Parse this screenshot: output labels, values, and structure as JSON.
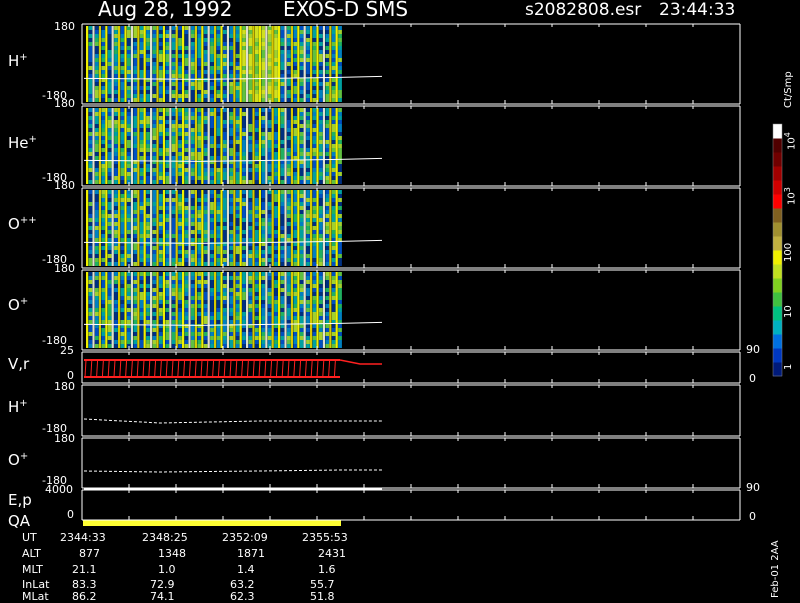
{
  "header": {
    "date": "Aug 28, 1992",
    "instrument": "EXOS-D SMS",
    "file": "s2082808.esr",
    "time": "23:44:33"
  },
  "panels": {
    "hplus": {
      "label": "H",
      "sup": "+",
      "ytop": "180",
      "ybot": "-180"
    },
    "heplus": {
      "label": "He",
      "sup": "+",
      "ytop": "180",
      "ybot": "-180"
    },
    "oplusplus": {
      "label": "O",
      "sup": "++",
      "ytop": "180",
      "ybot": "-180"
    },
    "oplus": {
      "label": "O",
      "sup": "+",
      "ytop": "180",
      "ybot": "-180"
    },
    "vr": {
      "label": "V,r",
      "ytop": "25",
      "ybot": "0",
      "rtop": "90",
      "rbot": "0"
    },
    "hplus2": {
      "label": "H",
      "sup": "+",
      "ytop": "180",
      "ybot": "-180"
    },
    "oplus2": {
      "label": "O",
      "sup": "+",
      "ytop": "180",
      "ybot": "-180"
    },
    "ep": {
      "label": "E,p",
      "ytop": "4000",
      "rtop": "90"
    },
    "qa": {
      "label": "QA",
      "ybot": "0",
      "rbot": "0"
    }
  },
  "colorbar": {
    "unit": "Ct/Smp",
    "ticks": [
      "1",
      "10",
      "100",
      "10",
      "10"
    ],
    "exponents": [
      "",
      "",
      "",
      "3",
      "4"
    ],
    "colors": [
      "#001a7a",
      "#0038c0",
      "#0070e0",
      "#00b0c0",
      "#00c080",
      "#40c040",
      "#80d020",
      "#c0e020",
      "#f0f000",
      "#c0b040",
      "#a09030",
      "#806020",
      "#ff0000",
      "#d00000",
      "#a00000",
      "#700000",
      "#500000",
      "#ffffff"
    ]
  },
  "footer": {
    "rows": [
      {
        "label": "UT",
        "values": [
          "2344:33",
          "2348:25",
          "2352:09",
          "2355:53"
        ]
      },
      {
        "label": "ALT",
        "values": [
          "877",
          "1348",
          "1871",
          "2431"
        ]
      },
      {
        "label": "MLT",
        "values": [
          "21.1",
          "1.0",
          "1.4",
          "1.6"
        ]
      },
      {
        "label": "InLat",
        "values": [
          "83.3",
          "72.9",
          "63.2",
          "55.7"
        ]
      },
      {
        "label": "MLat",
        "values": [
          "86.2",
          "74.1",
          "62.3",
          "51.8"
        ]
      }
    ],
    "stamp": "Feb-01 2AA"
  },
  "chart_data": {
    "type": "heatmap",
    "title": "Aug 28, 1992   EXOS-D SMS",
    "x": [
      "2344:33",
      "2348:25",
      "2352:09",
      "2355:53"
    ],
    "xlabel": "UT",
    "ylim": [
      -180,
      180
    ],
    "series": [
      {
        "name": "H+"
      },
      {
        "name": "He+"
      },
      {
        "name": "O++"
      },
      {
        "name": "O+"
      }
    ],
    "colorbar_range": [
      1,
      10000
    ],
    "colorbar_scale": "log"
  }
}
